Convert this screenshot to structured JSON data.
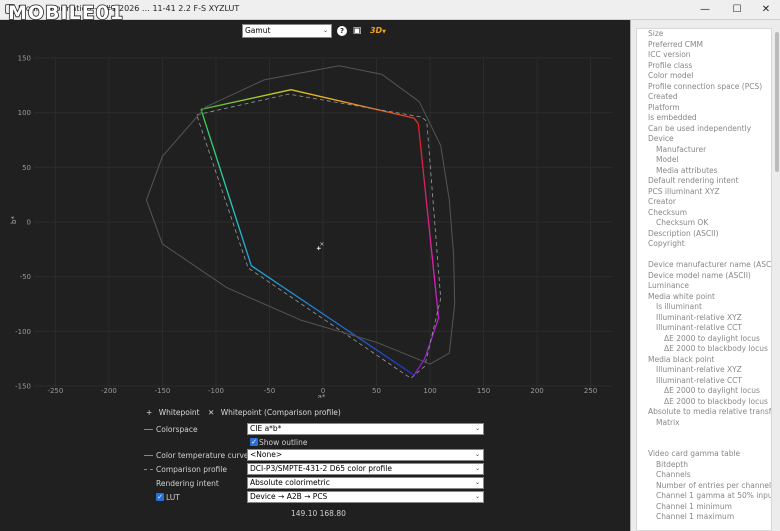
{
  "window": {
    "title": "Profile information — #1 2026 … 11-41 2.2 F-S XYZLUT",
    "watermark": "MOBILE01",
    "minimize": "—",
    "maximize": "☐",
    "close": "✕"
  },
  "toolbar": {
    "plot_select": "Gamut",
    "help_icon": "?",
    "image_icon": "▣",
    "threed_label": "3D"
  },
  "chart_data": {
    "type": "scatter",
    "title": "",
    "xlabel": "a*",
    "ylabel": "b*",
    "xlim": [
      -270,
      270
    ],
    "ylim": [
      -150,
      150
    ],
    "x_ticks": [
      -250,
      -200,
      -150,
      -100,
      -50,
      0,
      50,
      100,
      150,
      200,
      250
    ],
    "y_ticks": [
      150,
      100,
      50,
      0,
      -50,
      -100,
      -150
    ],
    "grid": true,
    "series": [
      {
        "name": "",
        "style": "gamut-colored",
        "points": [
          [
            -114,
            103
          ],
          [
            -30,
            121
          ],
          [
            85,
            95
          ],
          [
            89,
            90
          ],
          [
            108,
            -88
          ],
          [
            95,
            -125
          ],
          [
            85,
            -140
          ],
          [
            -67,
            -40
          ],
          [
            -114,
            103
          ]
        ]
      },
      {
        "name": "",
        "style": "dashed",
        "points": [
          [
            -118,
            98
          ],
          [
            -32,
            117
          ],
          [
            92,
            96
          ],
          [
            97,
            92
          ],
          [
            110,
            -70
          ],
          [
            95,
            -132
          ],
          [
            82,
            -143
          ],
          [
            -70,
            -42
          ],
          [
            -118,
            98
          ]
        ]
      },
      {
        "name": "",
        "style": "outline",
        "points": [
          [
            -165,
            20
          ],
          [
            -150,
            60
          ],
          [
            -110,
            105
          ],
          [
            -55,
            130
          ],
          [
            15,
            143
          ],
          [
            55,
            135
          ],
          [
            90,
            110
          ],
          [
            110,
            70
          ],
          [
            118,
            20
          ],
          [
            122,
            -30
          ],
          [
            123,
            -75
          ],
          [
            118,
            -120
          ],
          [
            100,
            -130
          ],
          [
            50,
            -110
          ],
          [
            -20,
            -90
          ],
          [
            -90,
            -60
          ],
          [
            -150,
            -20
          ],
          [
            -165,
            20
          ]
        ]
      }
    ],
    "whitepoints": [
      [
        -4,
        -24
      ],
      [
        -1,
        -20
      ]
    ]
  },
  "legend": {
    "whitepoint_marker": "+",
    "whitepoint": "Whitepoint",
    "comparison_marker": "✕",
    "comparison": "Whitepoint (Comparison profile)"
  },
  "form": {
    "colorspace_label": "Colorspace",
    "colorspace_value": "CIE a*b*",
    "show_outline_check": "✓",
    "show_outline_label": "Show outline",
    "color_temp_label": "Color temperature curve",
    "color_temp_value": "<None>",
    "comparison_label": "Comparison profile",
    "comparison_value": "DCI-P3/SMPTE-431-2 D65 color profile",
    "rendering_label": "Rendering intent",
    "rendering_value": "Absolute colorimetric",
    "lut_check": "✓",
    "lut_label": "LUT",
    "lut_value": "Device → A2B → PCS",
    "dropdown_arrow": "⌄"
  },
  "status": {
    "coords": "149.10 168.80"
  },
  "properties": [
    {
      "label": "Size",
      "indent": 0
    },
    {
      "label": "Preferred CMM",
      "indent": 0
    },
    {
      "label": "ICC version",
      "indent": 0
    },
    {
      "label": "Profile class",
      "indent": 0
    },
    {
      "label": "Color model",
      "indent": 0
    },
    {
      "label": "Profile connection space (PCS)",
      "indent": 0
    },
    {
      "label": "Created",
      "indent": 0
    },
    {
      "label": "Platform",
      "indent": 0
    },
    {
      "label": "Is embedded",
      "indent": 0
    },
    {
      "label": "Can be used independently",
      "indent": 0
    },
    {
      "label": "Device",
      "indent": 0
    },
    {
      "label": "Manufacturer",
      "indent": 1
    },
    {
      "label": "Model",
      "indent": 1
    },
    {
      "label": "Media attributes",
      "indent": 1
    },
    {
      "label": "Default rendering intent",
      "indent": 0
    },
    {
      "label": "PCS illuminant XYZ",
      "indent": 0
    },
    {
      "label": "Creator",
      "indent": 0
    },
    {
      "label": "Checksum",
      "indent": 0
    },
    {
      "label": "Checksum OK",
      "indent": 1
    },
    {
      "label": "Description (ASCII)",
      "indent": 0
    },
    {
      "label": "Copyright",
      "indent": 0
    },
    {
      "label": "",
      "indent": 0
    },
    {
      "label": "Device manufacturer name (ASCII)",
      "indent": 0
    },
    {
      "label": "Device model name (ASCII)",
      "indent": 0
    },
    {
      "label": "Luminance",
      "indent": 0
    },
    {
      "label": "Media white point",
      "indent": 0
    },
    {
      "label": "Is illuminant",
      "indent": 1
    },
    {
      "label": "Illuminant-relative XYZ",
      "indent": 1
    },
    {
      "label": "Illuminant-relative CCT",
      "indent": 1
    },
    {
      "label": "ΔE 2000 to daylight locus",
      "indent": 2
    },
    {
      "label": "ΔE 2000 to blackbody locus",
      "indent": 2
    },
    {
      "label": "Media black point",
      "indent": 0
    },
    {
      "label": "Illuminant-relative XYZ",
      "indent": 1
    },
    {
      "label": "Illuminant-relative CCT",
      "indent": 1
    },
    {
      "label": "ΔE 2000 to daylight locus",
      "indent": 2
    },
    {
      "label": "ΔE 2000 to blackbody locus",
      "indent": 2
    },
    {
      "label": "Absolute to media relative transform",
      "indent": 0
    },
    {
      "label": "Matrix",
      "indent": 1
    },
    {
      "label": "",
      "indent": 0
    },
    {
      "label": "",
      "indent": 0
    },
    {
      "label": "Video card gamma table",
      "indent": 0
    },
    {
      "label": "Bitdepth",
      "indent": 1
    },
    {
      "label": "Channels",
      "indent": 1
    },
    {
      "label": "Number of entries per channel",
      "indent": 1
    },
    {
      "label": "Channel 1 gamma at 50% input",
      "indent": 1
    },
    {
      "label": "Channel 1 minimum",
      "indent": 1
    },
    {
      "label": "Channel 1 maximum",
      "indent": 1
    }
  ]
}
